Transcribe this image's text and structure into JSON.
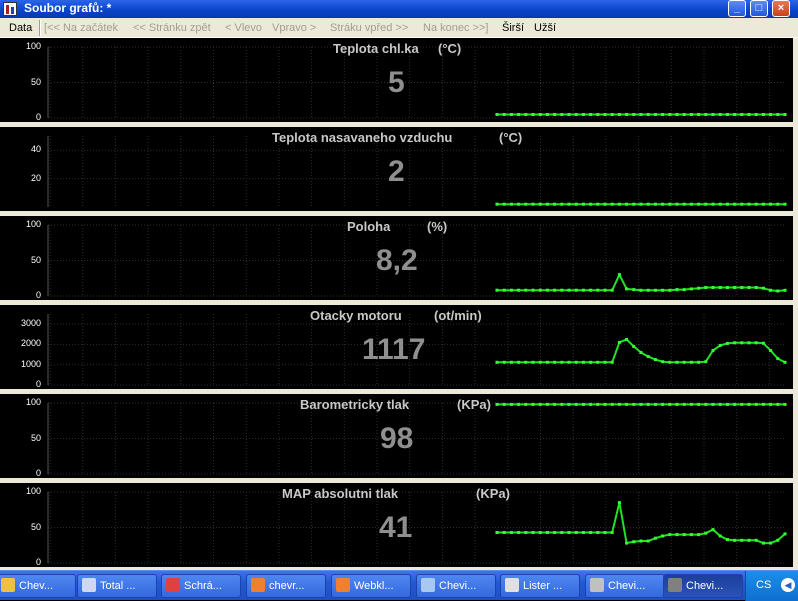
{
  "window": {
    "title": "Soubor grafů:  *"
  },
  "menu": {
    "data": "Data",
    "start": "[<< Na začátek",
    "prev": "<< Stránku zpět",
    "left": "< Vlevo",
    "right": "Vpravo >",
    "next": "Stráku vpřed >>",
    "end": "Na konec >>]",
    "wider": "Širší",
    "narrower": "Užší"
  },
  "panels": [
    {
      "title": "Teplota chl.ka",
      "unit": "(°C)",
      "value": "5",
      "yticks": [
        "100",
        "50",
        "0"
      ],
      "ymin": 0,
      "ymax": 100,
      "series": [
        5,
        5,
        5,
        5,
        5,
        5,
        5,
        5,
        5,
        5,
        5,
        5,
        5,
        5,
        5,
        5,
        5,
        5,
        5,
        5,
        5,
        5,
        5,
        5,
        5,
        5,
        5,
        5,
        5,
        5,
        5,
        5,
        5,
        5,
        5,
        5,
        5,
        5,
        5,
        5,
        5
      ]
    },
    {
      "title": "Teplota nasavaneho vzduchu",
      "unit": "(°C)",
      "value": "2",
      "yticks": [
        "40",
        "20"
      ],
      "ymin": 0,
      "ymax": 50,
      "series": [
        2,
        2,
        2,
        2,
        2,
        2,
        2,
        2,
        2,
        2,
        2,
        2,
        2,
        2,
        2,
        2,
        2,
        2,
        2,
        2,
        2,
        2,
        2,
        2,
        2,
        2,
        2,
        2,
        2,
        2,
        2,
        2,
        2,
        2,
        2,
        2,
        2,
        2,
        2,
        2,
        2
      ]
    },
    {
      "title": "Poloha",
      "unit": "(%)",
      "value": "8,2",
      "yticks": [
        "100",
        "50",
        "0"
      ],
      "ymin": 0,
      "ymax": 100,
      "series": [
        8.2,
        8.2,
        8.2,
        8.2,
        8.2,
        8.2,
        8.2,
        8.2,
        8.2,
        8.2,
        8.2,
        8.2,
        8.2,
        8.2,
        8.2,
        8.2,
        8.2,
        30,
        10,
        9,
        8,
        8,
        8,
        8,
        8,
        9,
        9,
        10,
        11,
        12,
        12,
        12,
        12,
        12,
        12,
        12,
        12,
        11,
        8,
        7,
        8
      ]
    },
    {
      "title": "Otacky motoru",
      "unit": "(ot/min)",
      "value": "1117",
      "yticks": [
        "3000",
        "2000",
        "1000",
        "0"
      ],
      "ymin": 0,
      "ymax": 3500,
      "series": [
        1117,
        1117,
        1117,
        1117,
        1117,
        1117,
        1117,
        1117,
        1117,
        1117,
        1117,
        1117,
        1117,
        1117,
        1117,
        1117,
        1117,
        2100,
        2250,
        1900,
        1600,
        1400,
        1250,
        1150,
        1120,
        1117,
        1117,
        1117,
        1117,
        1150,
        1700,
        1950,
        2050,
        2080,
        2080,
        2080,
        2080,
        2060,
        1700,
        1300,
        1117
      ]
    },
    {
      "title": "Barometricky tlak",
      "unit": "(KPa)",
      "value": "98",
      "yticks": [
        "100",
        "50",
        "0"
      ],
      "ymin": 0,
      "ymax": 100,
      "series": [
        98,
        98,
        98,
        98,
        98,
        98,
        98,
        98,
        98,
        98,
        98,
        98,
        98,
        98,
        98,
        98,
        98,
        98,
        98,
        98,
        98,
        98,
        98,
        98,
        98,
        98,
        98,
        98,
        98,
        98,
        98,
        98,
        98,
        98,
        98,
        98,
        98,
        98,
        98,
        98,
        98
      ]
    },
    {
      "title": "MAP absolutni tlak",
      "unit": "(KPa)",
      "value": "41",
      "yticks": [
        "100",
        "50",
        "0"
      ],
      "ymin": 0,
      "ymax": 100,
      "series": [
        43,
        43,
        43,
        43,
        43,
        43,
        43,
        43,
        43,
        43,
        43,
        43,
        43,
        43,
        43,
        43,
        43,
        85,
        28,
        30,
        31,
        31,
        35,
        38,
        40,
        40,
        40,
        40,
        40,
        42,
        47,
        38,
        33,
        32,
        32,
        32,
        32,
        28,
        28,
        32,
        41
      ]
    }
  ],
  "taskbar": [
    {
      "label": "Chev...",
      "icon": "chevrolet-icon",
      "color": "#f0c040"
    },
    {
      "label": "Total ...",
      "icon": "floppy-icon",
      "color": "#d0d8f0"
    },
    {
      "label": "Schrá...",
      "icon": "clipboard-icon",
      "color": "#e04040"
    },
    {
      "label": "chevr...",
      "icon": "firefox-icon",
      "color": "#f08030"
    },
    {
      "label": "Webkl...",
      "icon": "firefox-icon",
      "color": "#f08030"
    },
    {
      "label": "Chevi...",
      "icon": "document-icon",
      "color": "#a8c8f0"
    },
    {
      "label": "Lister ...",
      "icon": "list-icon",
      "color": "#e0e0e0"
    },
    {
      "label": "Chevi...",
      "icon": "shield-icon",
      "color": "#c0c0c0"
    },
    {
      "label": "Chevi...",
      "icon": "car-icon",
      "color": "#808080"
    }
  ],
  "tray": {
    "lang": "CS"
  }
}
